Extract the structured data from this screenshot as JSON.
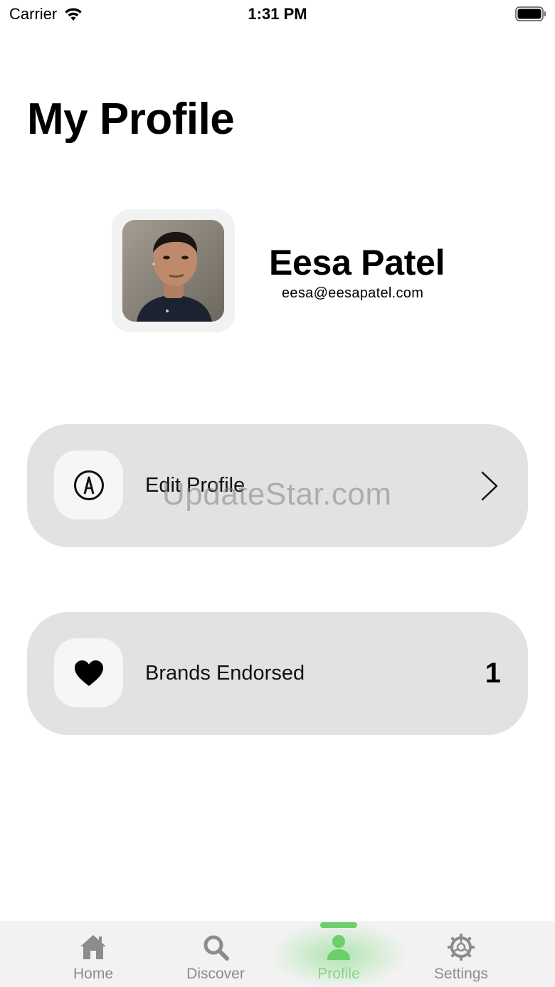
{
  "status_bar": {
    "carrier": "Carrier",
    "time": "1:31 PM"
  },
  "page": {
    "title": "My Profile"
  },
  "profile": {
    "name": "Eesa Patel",
    "email": "eesa@eesapatel.com"
  },
  "cards": {
    "edit_profile": {
      "label": "Edit Profile",
      "icon": "pen-circle-icon"
    },
    "brands_endorsed": {
      "label": "Brands Endorsed",
      "count": "1",
      "icon": "heart-icon"
    }
  },
  "watermark": "UpdateStar.com",
  "tab_bar": {
    "active": "Profile",
    "tabs": [
      {
        "label": "Home",
        "icon": "house-icon"
      },
      {
        "label": "Discover",
        "icon": "search-icon"
      },
      {
        "label": "Profile",
        "icon": "person-icon"
      },
      {
        "label": "Settings",
        "icon": "gear-icon"
      }
    ]
  },
  "colors": {
    "accent": "#6bcf6b",
    "card_background": "#e2e2e2",
    "tab_inactive": "#8c8c8c"
  }
}
